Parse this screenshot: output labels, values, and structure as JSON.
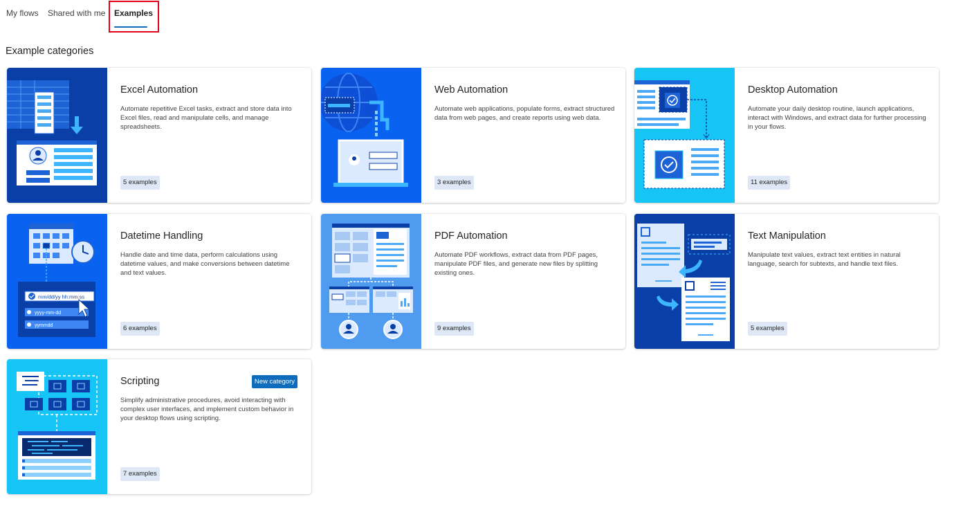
{
  "tabs": {
    "my_flows": "My flows",
    "shared": "Shared with me",
    "examples": "Examples",
    "active": "Examples"
  },
  "section_title": "Example categories",
  "colors": {
    "accent": "#0f6cbd",
    "highlight": "#e0001a",
    "badge_bg": "#dde7f6"
  },
  "cards": [
    {
      "title": "Excel Automation",
      "description": "Automate repetitive Excel tasks, extract and store data into Excel files, read and manipulate cells, and manage spreadsheets.",
      "count": "5 examples",
      "icon": "excel-automation-illustration"
    },
    {
      "title": "Web Automation",
      "description": "Automate web applications, populate forms, extract structured data from web pages, and create reports using web data.",
      "count": "3 examples",
      "icon": "web-automation-illustration"
    },
    {
      "title": "Desktop Automation",
      "description": "Automate your daily desktop routine, launch applications, interact with Windows, and extract data for further processing in your flows.",
      "count": "11 examples",
      "icon": "desktop-automation-illustration"
    },
    {
      "title": "Datetime Handling",
      "description": "Handle date and time data, perform calculations using datetime values, and make conversions between datetime and text values.",
      "count": "6 examples",
      "icon": "datetime-handling-illustration",
      "illustration_text": [
        "mm/dd/yy hh:mm:ss",
        "yyyy-mm-dd",
        "yymmdd"
      ]
    },
    {
      "title": "PDF Automation",
      "description": "Automate PDF workflows, extract data from PDF pages, manipulate PDF files, and generate new files by splitting existing ones.",
      "count": "9 examples",
      "icon": "pdf-automation-illustration"
    },
    {
      "title": "Text Manipulation",
      "description": "Manipulate text values, extract text entities in natural language, search for subtexts, and handle text files.",
      "count": "5 examples",
      "icon": "text-manipulation-illustration"
    },
    {
      "title": "Scripting",
      "description": "Simplify administrative procedures, avoid interacting with complex user interfaces, and implement custom behavior in your desktop flows using scripting.",
      "count": "7 examples",
      "icon": "scripting-illustration",
      "tag": "New category"
    }
  ]
}
